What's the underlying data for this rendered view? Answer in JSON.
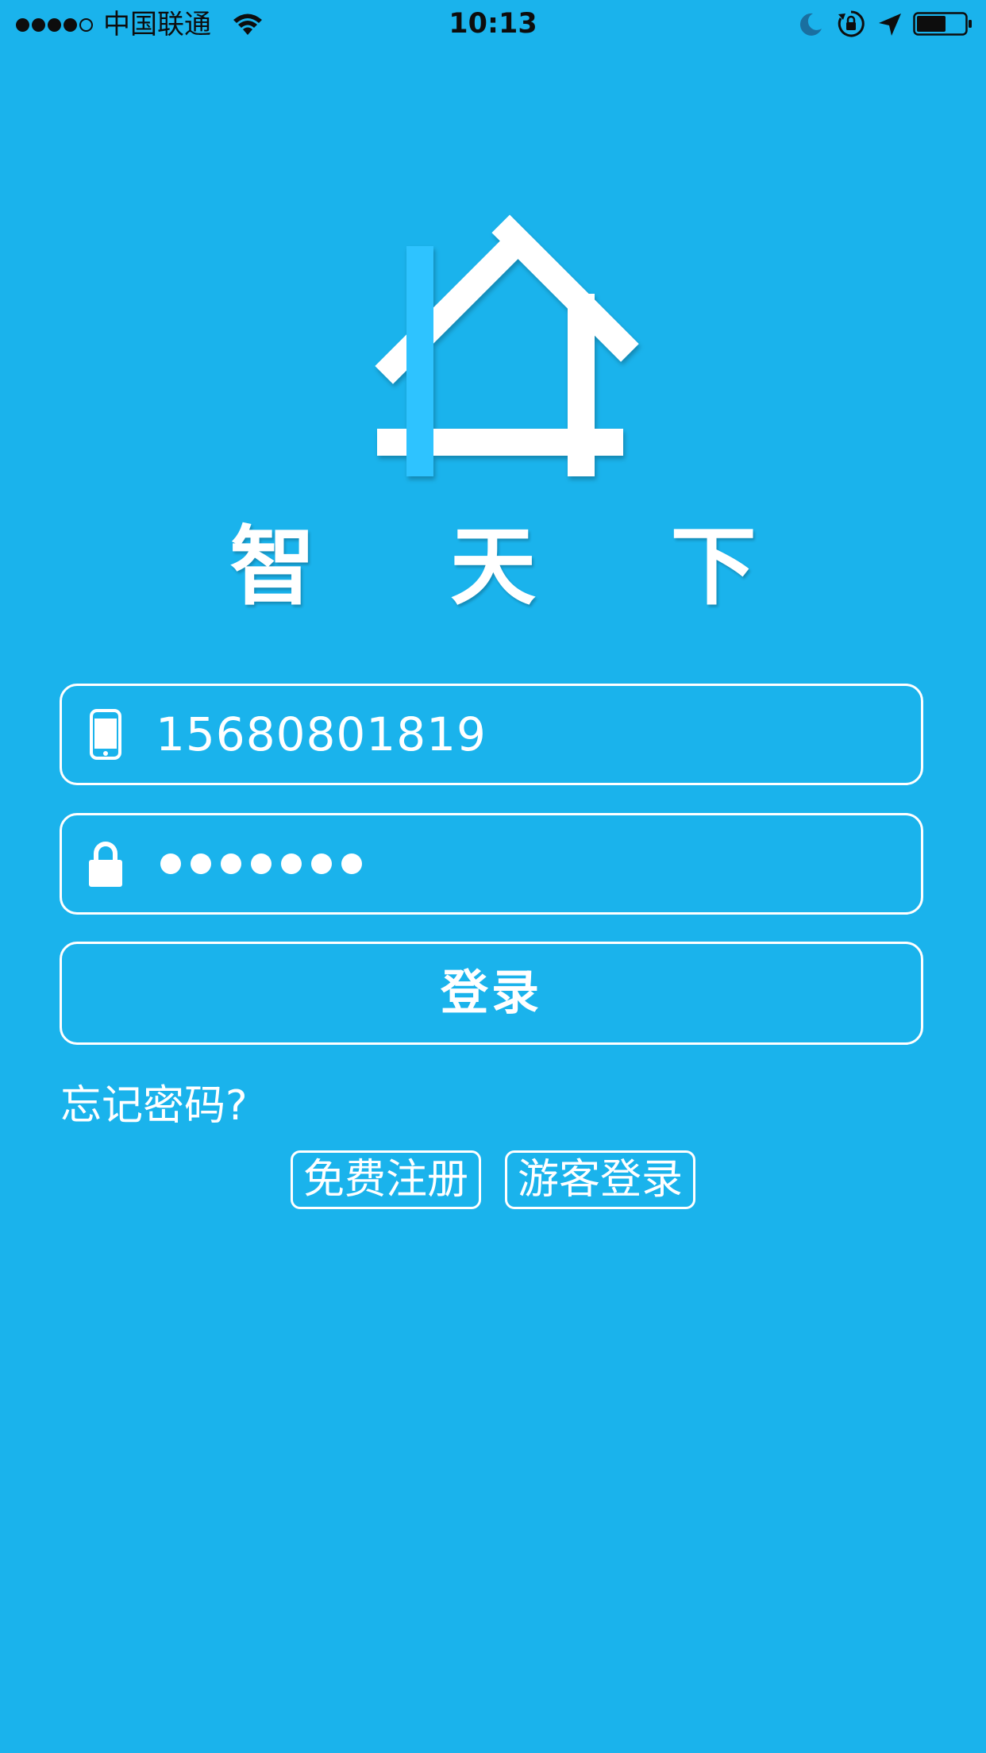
{
  "status_bar": {
    "carrier": "中国联通",
    "time": "10:13",
    "signal_bars_filled": 4,
    "signal_bars_total": 5,
    "battery_level": 0.6,
    "icons": [
      "signal-icon",
      "wifi-icon",
      "moon-icon",
      "rotation-lock-icon",
      "location-icon",
      "battery-icon"
    ]
  },
  "brand": {
    "title": "智 天 下",
    "logo_icon": "house-icon"
  },
  "login_form": {
    "phone": {
      "icon": "phone-icon",
      "value": "15680801819"
    },
    "password": {
      "icon": "lock-icon",
      "masked_length": 7
    },
    "login_label": "登录",
    "forgot_password_label": "忘记密码?",
    "register_label": "免费注册",
    "guest_login_label": "游客登录"
  },
  "colors": {
    "background": "#1ab3ec",
    "foreground": "#ffffff",
    "logo_accent": "#2ec3ff",
    "status_text": "#0d0d0d"
  }
}
